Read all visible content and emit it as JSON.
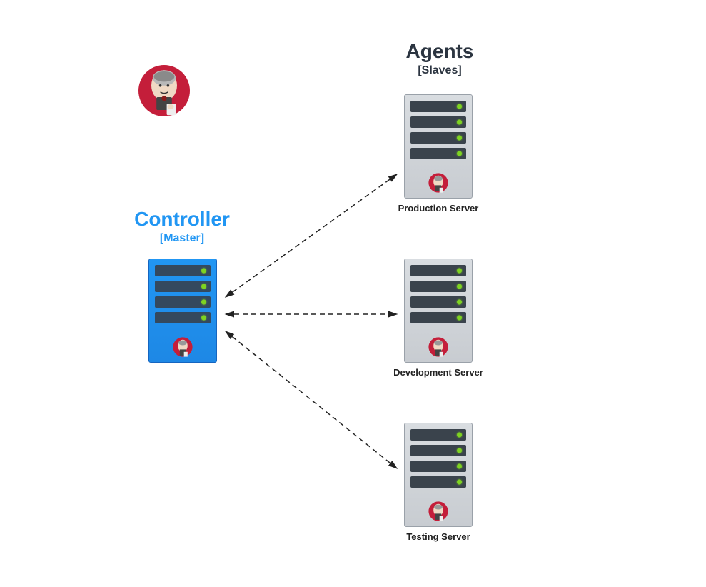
{
  "controller": {
    "title": "Controller",
    "subtitle": "[Master]"
  },
  "agents": {
    "title": "Agents",
    "subtitle": "[Slaves]"
  },
  "servers": {
    "production": {
      "label": "Production Server"
    },
    "development": {
      "label": "Development Server"
    },
    "testing": {
      "label": "Testing Server"
    }
  },
  "icons": {
    "jenkins_logo": "jenkins-logo",
    "jenkins_mascot": "jenkins-mascot"
  }
}
